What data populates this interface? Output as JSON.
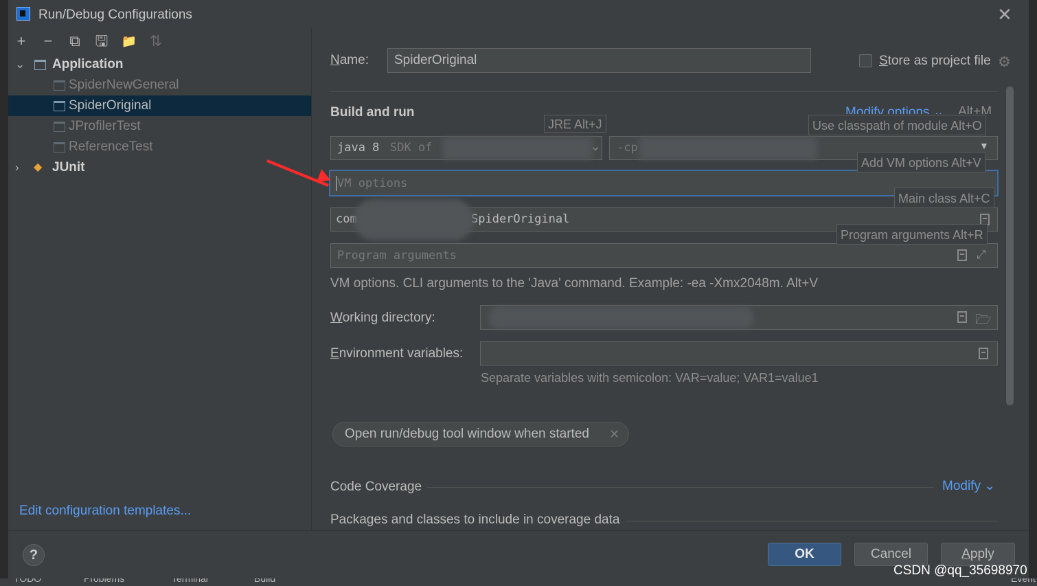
{
  "window": {
    "title": "Run/Debug Configurations",
    "close_glyph": "✕",
    "app_icon": "intellij-idea-icon"
  },
  "toolbar": {
    "add": "+",
    "remove": "−",
    "copy": "⧉",
    "save": "🖫",
    "folder": "📁",
    "sort": "⇅"
  },
  "tree": {
    "group_application": "Application",
    "items": [
      "SpiderNewGeneral",
      "SpiderOriginal",
      "JProfilerTest",
      "ReferenceTest"
    ],
    "selected": "SpiderOriginal",
    "group_junit": "JUnit"
  },
  "edit_templates_link": "Edit configuration templates...",
  "form": {
    "name_label_hotkey": "N",
    "name_label_rest": "ame:",
    "name_value": "SpiderOriginal",
    "store_label_hotkey": "S",
    "store_label_rest": "tore as project file",
    "store_checked": false,
    "build_and_run": "Build and run",
    "modify_options": "Modify options",
    "modify_options_hint": "Alt+M",
    "jre_value": "java 8",
    "jre_suffix": "SDK of",
    "jre_hint": "JRE Alt+J",
    "classpath_prefix": "-cp",
    "classpath_hint": "Use classpath of module Alt+O",
    "vm_options_placeholder": "VM options",
    "add_vm_hint": "Add VM options Alt+V",
    "main_class_prefix": "com",
    "main_class_suffix": "SpiderOriginal",
    "main_class_hint": "Main class Alt+C",
    "program_args_placeholder": "Program arguments",
    "program_args_hint": "Program arguments Alt+R",
    "vm_help": "VM options. CLI arguments to the 'Java' command. Example: -ea -Xmx2048m. Alt+V",
    "working_dir_hotkey": "W",
    "working_dir_rest": "orking directory:",
    "env_hotkey": "E",
    "env_rest": "nvironment variables:",
    "env_help": "Separate variables with semicolon: VAR=value; VAR1=value1",
    "open_tool_window_pill": "Open run/debug tool window when started",
    "code_coverage": "Code Coverage",
    "modify": "Modify",
    "packages_label": "Packages and classes to include in coverage data"
  },
  "buttons": {
    "ok": "OK",
    "cancel": "Cancel",
    "apply_hotkey": "A",
    "apply_rest": "pply",
    "help": "?"
  },
  "statusbar": [
    "TODO",
    "Problems",
    "Terminal",
    "Build",
    "Event"
  ],
  "watermark": "CSDN @qq_35698970",
  "colors": {
    "background": "#3c3f41",
    "selection": "#0d293e",
    "link": "#589df6",
    "primary_button": "#365880",
    "focus_border": "#3d6fa5",
    "annotation_arrow": "#ff2b2b"
  }
}
